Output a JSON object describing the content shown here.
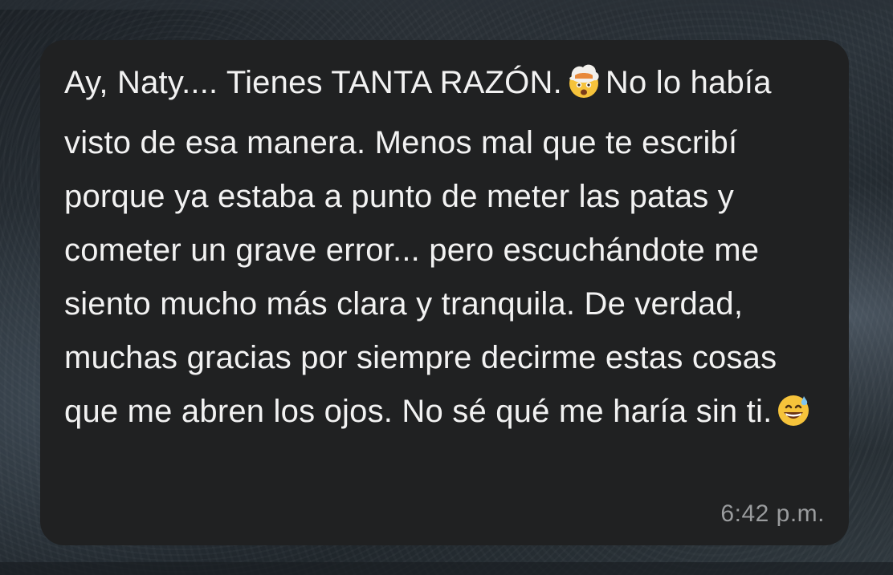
{
  "message": {
    "segments": [
      "Ay, Naty.... Tienes TANTA RAZÓN.",
      "No lo había visto de esa manera. Menos mal que te escribí porque ya estaba a punto de meter las patas y cometer un grave error... pero escuchándote me siento mucho más clara y tranquila. De verdad, muchas gracias por siempre decirme estas cosas que me abren los ojos. No sé qué me haría sin ti."
    ],
    "emojis": [
      "exploding-head-emoji",
      "grinning-sweat-emoji"
    ],
    "timestamp": "6:42 p.m."
  },
  "colors": {
    "bubble": "#202122",
    "text": "#f2f2f2",
    "timestamp": "#9a9c9e"
  }
}
